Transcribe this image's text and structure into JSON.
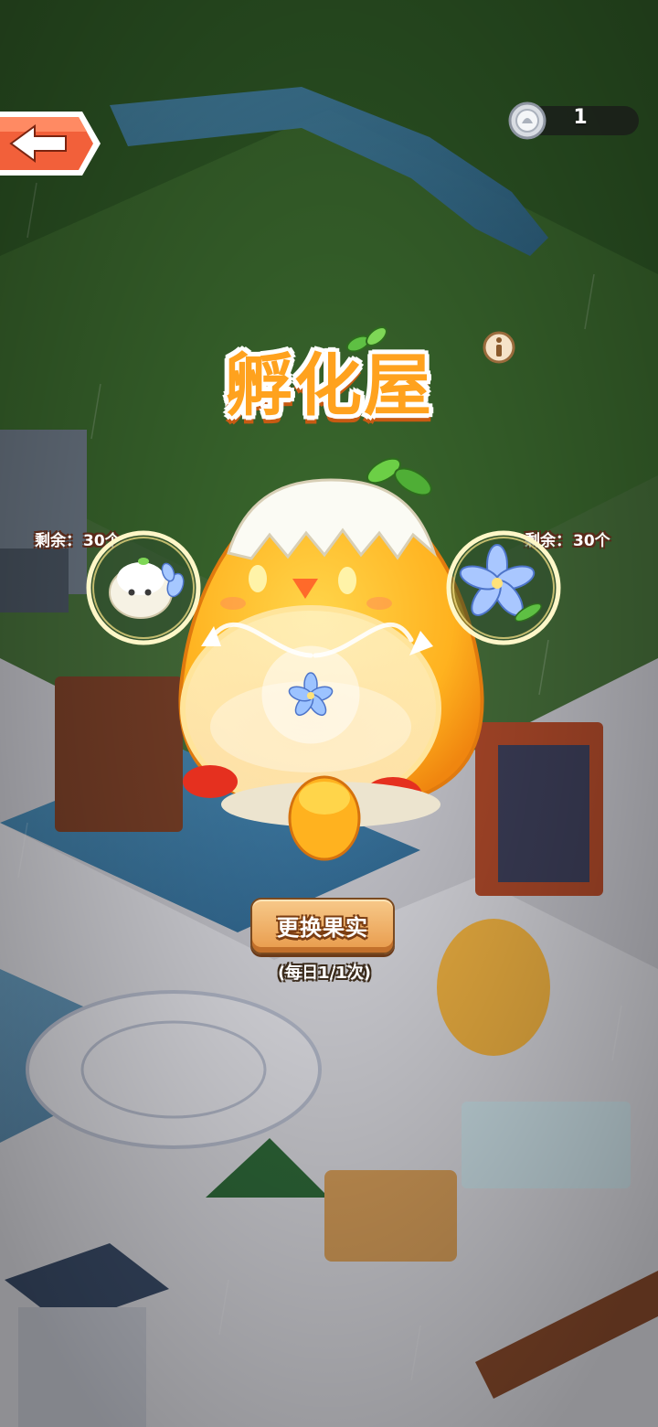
{
  "header": {
    "back_label": "",
    "currency": {
      "icon": "silver-coin-icon",
      "count": "1"
    }
  },
  "hatch_house": {
    "title": "孵化屋",
    "info_icon": "info-icon",
    "left_slot": {
      "remaining_label": "剩余：",
      "remaining_count": "30个",
      "item_icon": "white-sprite-icon"
    },
    "right_slot": {
      "remaining_label": "剩余：",
      "remaining_count": "30个",
      "item_icon": "blue-lily-flower-icon"
    },
    "change_button_label": "更换果实",
    "daily_limit_text": "(每日1/1次)"
  },
  "colors": {
    "title_orange": "#ffa21e",
    "button_orange": "#e89a4a",
    "grass": "#3d6a30",
    "water": "#3f7fa8"
  }
}
